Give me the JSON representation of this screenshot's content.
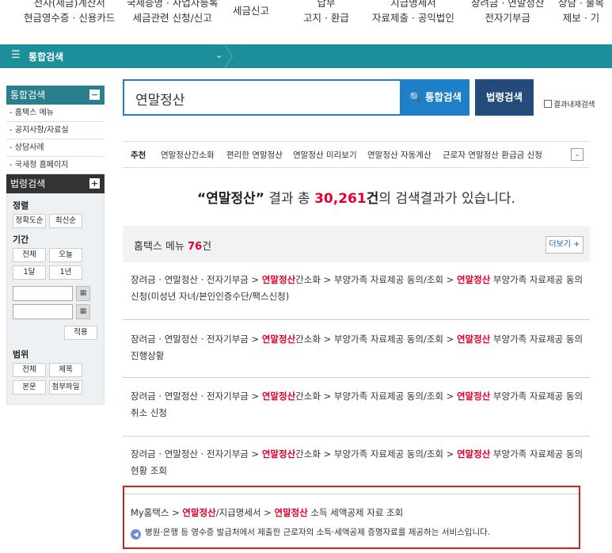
{
  "top_nav": [
    {
      "line1": "전자(세금)계산서",
      "line2": "현금영수증 · 신용카드"
    },
    {
      "line1": "국세증명 · 사업자등록",
      "line2": "세금관련 신청/신고"
    },
    {
      "line1": "세금신고",
      "line2": ""
    },
    {
      "line1": "납부",
      "line2": "고지 · 환급"
    },
    {
      "line1": "지급명세서",
      "line2": "자료제출 · 공익법인"
    },
    {
      "line1": "장려금 · 연말정산",
      "line2": "전자기부금"
    },
    {
      "line1": "상담 · 불복",
      "line2": "제보 · 기"
    }
  ],
  "breadcrumb_bar": {
    "menu_icon": "☰",
    "label": "통합검색",
    "chevron": "⌄"
  },
  "sidebar": {
    "integrated_title": "통합검색",
    "integrated_toggle": "−",
    "links": [
      "- 홈택스 메뉴",
      "- 공지사항/자료실",
      "- 상담사례",
      "- 국세청 홈페이지"
    ],
    "law_title": "법령검색",
    "law_toggle": "+",
    "sort_label": "정렬",
    "sort_buttons": [
      "정확도순",
      "최신순"
    ],
    "period_label": "기간",
    "period_buttons": [
      "전체",
      "오늘",
      "1달",
      "1년"
    ],
    "calendar_icon": "▦",
    "apply_label": "적용",
    "scope_label": "범위",
    "scope_buttons": [
      "전체",
      "제목",
      "본문",
      "첨부파일"
    ]
  },
  "search": {
    "query": "연말정산",
    "search_button": "🔍 통합검색",
    "law_button": "법령검색",
    "within_label": "결과내재검색"
  },
  "recommend": {
    "label": "추천",
    "items": [
      "연말정산간소화",
      "편리한 연말정산",
      "연말정산 미리보기",
      "연말정산 자동계산",
      "근로자 연말정산 환급금 신청"
    ],
    "expand_icon": "⌄"
  },
  "summary": {
    "keyword": "“연말정산”",
    "text1": " 결과 총 ",
    "count": "30,261",
    "unit": "건",
    "text2": "의 검색결과가 있습니다."
  },
  "section": {
    "title": "홈택스 메뉴 ",
    "count": "76",
    "unit": "건",
    "more_label": "더보기 +"
  },
  "results": [
    {
      "pre": "장려금 · 연말정산 · 전자기부금 > ",
      "hl1": "연말정산",
      "mid": "간소화 > 부양가족 자료제공 동의/조회 > ",
      "hl2": "연말정산",
      "post": " 부양가족 자료제공 동의 신청(미성년 자녀/본인인증수단/팩스신청)"
    },
    {
      "pre": "장려금 · 연말정산 · 전자기부금 > ",
      "hl1": "연말정산",
      "mid": "간소화 > 부양가족 자료제공 동의/조회 > ",
      "hl2": "연말정산",
      "post": " 부양가족 자료제공 동의 진행상황"
    },
    {
      "pre": "장려금 · 연말정산 · 전자기부금 > ",
      "hl1": "연말정산",
      "mid": "간소화 > 부양가족 자료제공 동의/조회 > ",
      "hl2": "연말정산",
      "post": " 부양가족 자료제공 동의 취소 신청"
    },
    {
      "pre": "장려금 · 연말정산 · 전자기부금 > ",
      "hl1": "연말정산",
      "mid": "간소화 > 부양가족 자료제공 동의/조회 > ",
      "hl2": "연말정산",
      "post": " 부양가족 자료제공 동의 현황 조회"
    }
  ],
  "highlighted_result": {
    "pre": "My홈택스 > ",
    "hl1": "연말정산",
    "mid": "/지급명세서 > ",
    "hl2": "연말정산",
    "post": " 소득 세액공제 자료 조회",
    "desc_icon": "◀",
    "desc": "병원·은행 등 영수증 발급처에서 제출한 근로자의 소득·세액공제 증명자료를 제공하는 서비스입니다."
  },
  "colors": {
    "bar": "#1d8f9b",
    "search_blue": "#1f7fc7",
    "law_navy": "#244b7a",
    "highlight_red": "#e4002b",
    "box_red": "#d82020"
  }
}
